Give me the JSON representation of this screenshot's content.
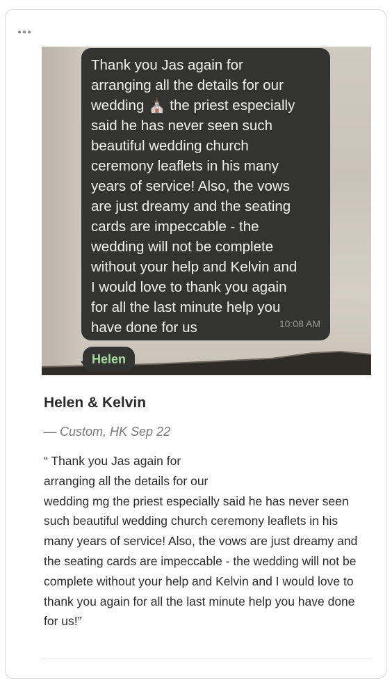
{
  "message": {
    "text": "Thank you Jas again for\narranging all the details for our\nwedding ⛪ the priest especially\nsaid he has never seen such\nbeautiful wedding church\nceremony leaflets in his many\nyears of service! Also, the vows\nare just dreamy and the seating\ncards are impeccable - the\nwedding will not be complete\nwithout your help and Kelvin and\nI would love to thank you again\nfor all the last minute help you\nhave done for us",
    "time": "10:08 AM",
    "sender_name": "Helen",
    "icon": "wedding-chapel-emoji"
  },
  "review": {
    "title": "Helen & Kelvin",
    "meta": "— Custom, HK Sep 22",
    "quote": "“ Thank you Jas again for\narranging all the details for our\nwedding mg the priest especially said he has never seen such beautiful wedding church ceremony leaflets in his many years of service! Also, the vows are just dreamy and the seating cards are impeccable - the wedding will not be complete without your help and Kelvin and I would love to thank you again for all the last minute help you have done for us!”"
  },
  "colors": {
    "bubble": "#333331",
    "sender_name": "#a6dba0",
    "meta_text": "#777777",
    "border": "#d9d9d9"
  },
  "menu_icon": "more-dots-icon"
}
